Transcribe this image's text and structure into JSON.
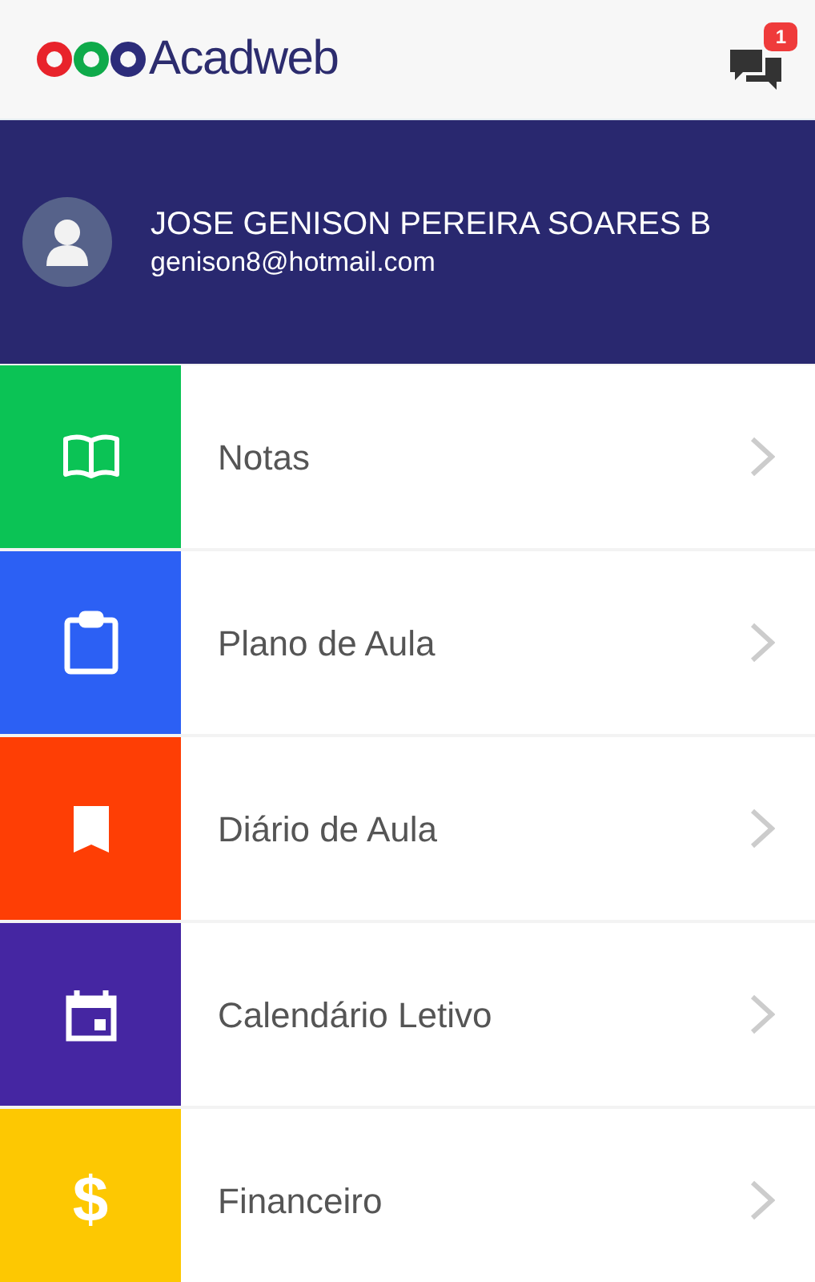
{
  "header": {
    "logo_text": "Acadweb",
    "notification_count": "1"
  },
  "user": {
    "name": "JOSE GENISON PEREIRA SOARES B",
    "email": "genison8@hotmail.com"
  },
  "menu": [
    {
      "label": "Notas",
      "kind": "book",
      "color": "#0bc355"
    },
    {
      "label": "Plano de Aula",
      "kind": "clipboard",
      "color": "#2c60f4"
    },
    {
      "label": "Diário de Aula",
      "kind": "bookmark",
      "color": "#fe3e05"
    },
    {
      "label": "Calendário Letivo",
      "kind": "calendar",
      "color": "#4526a2"
    },
    {
      "label": "Financeiro",
      "kind": "glyph",
      "glyph": "$",
      "color": "#fdc802"
    }
  ]
}
